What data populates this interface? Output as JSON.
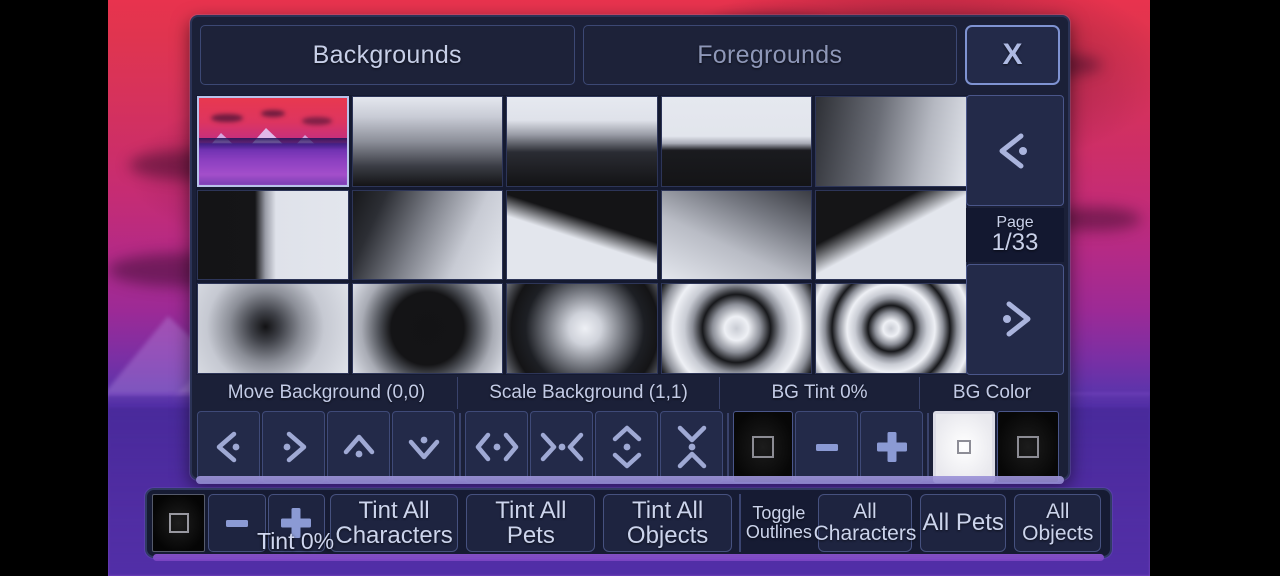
{
  "window": {
    "tabs": [
      {
        "label": "Backgrounds",
        "active": true
      },
      {
        "label": "Foregrounds",
        "active": false
      }
    ],
    "close_label": "X"
  },
  "pager": {
    "prev_icon": "chevron-left-dot-icon",
    "next_icon": "chevron-right-dot-icon",
    "page_word": "Page",
    "page_value": "1/33"
  },
  "grid": {
    "selected_index": 0,
    "thumbnails": [
      {
        "name": "thumb-mountain-scene",
        "kind": "image"
      },
      {
        "name": "thumb-gradient-vertical-light-dark",
        "kind": "gradient"
      },
      {
        "name": "thumb-gradient-vertical-hard-edge",
        "kind": "gradient"
      },
      {
        "name": "thumb-gradient-split-horizontal",
        "kind": "gradient"
      },
      {
        "name": "thumb-gradient-diagonal-dark-light",
        "kind": "gradient"
      },
      {
        "name": "thumb-gradient-vertical-split-left",
        "kind": "gradient"
      },
      {
        "name": "thumb-gradient-diagonal-corner",
        "kind": "gradient"
      },
      {
        "name": "thumb-gradient-triangle-wedge",
        "kind": "gradient"
      },
      {
        "name": "thumb-gradient-soft-diagonal",
        "kind": "gradient"
      },
      {
        "name": "thumb-gradient-angled-beam",
        "kind": "gradient"
      },
      {
        "name": "thumb-radial-small-dark-center",
        "kind": "radial"
      },
      {
        "name": "thumb-radial-large-dark-circle",
        "kind": "radial"
      },
      {
        "name": "thumb-radial-light-center",
        "kind": "radial"
      },
      {
        "name": "thumb-radial-rings-wide",
        "kind": "rings"
      },
      {
        "name": "thumb-radial-rings-tight",
        "kind": "rings"
      }
    ]
  },
  "sections": [
    {
      "name": "move-background",
      "label": "Move Background (0,0)"
    },
    {
      "name": "scale-background",
      "label": "Scale Background (1,1)"
    },
    {
      "name": "bg-tint",
      "label": "BG Tint 0%"
    },
    {
      "name": "bg-color",
      "label": "BG Color"
    }
  ],
  "controls": {
    "move": [
      {
        "name": "move-left-button",
        "icon": "chevron-left-dot-icon"
      },
      {
        "name": "move-right-button",
        "icon": "chevron-right-dot-icon"
      },
      {
        "name": "move-up-button",
        "icon": "chevron-up-dot-icon"
      },
      {
        "name": "move-down-button",
        "icon": "chevron-down-dot-icon"
      }
    ],
    "scale": [
      {
        "name": "scale-expand-horizontal-button",
        "icon": "expand-horizontal-icon"
      },
      {
        "name": "scale-contract-horizontal-button",
        "icon": "contract-horizontal-icon"
      },
      {
        "name": "scale-expand-vertical-button",
        "icon": "expand-vertical-icon"
      },
      {
        "name": "scale-contract-vertical-button",
        "icon": "contract-vertical-icon"
      }
    ],
    "tint": {
      "swatch_name": "bg-tint-swatch",
      "minus_label": "–",
      "plus_label": "+"
    },
    "color": {
      "white_swatch_name": "bg-color-white-swatch",
      "black_swatch_name": "bg-color-black-swatch",
      "selected": "white"
    }
  },
  "toolbar": {
    "tint_swatch_name": "global-tint-swatch",
    "minus_label": "–",
    "plus_label": "+",
    "tint_readout": "Tint 0%",
    "buttons": [
      {
        "name": "tint-all-characters-button",
        "line1": "Tint All",
        "line2": "Characters",
        "size": "b1"
      },
      {
        "name": "tint-all-pets-button",
        "line1": "Tint All",
        "line2": "Pets",
        "size": "b1"
      },
      {
        "name": "tint-all-objects-button",
        "line1": "Tint All",
        "line2": "Objects",
        "size": "b1"
      }
    ],
    "toggle_outlines": {
      "line1": "Toggle",
      "line2": "Outlines"
    },
    "outline_buttons": [
      {
        "name": "all-characters-button",
        "line1": "All",
        "line2": "Characters",
        "size": "b2"
      },
      {
        "name": "all-pets-button",
        "line1": "All Pets",
        "line2": "",
        "size": "b1"
      },
      {
        "name": "all-objects-button",
        "line1": "All",
        "line2": "Objects",
        "size": "b2"
      }
    ]
  },
  "colors": {
    "panel_bg": "#1b2038",
    "panel_border": "#2b3356",
    "accent_text": "#c7cfe8",
    "button_bg": "#232a49",
    "button_border": "#46517f",
    "highlight_border": "#7f93d2",
    "wallpaper_top": "#e8334e",
    "wallpaper_mid": "#b42a86",
    "wallpaper_bottom": "#7b45bf"
  }
}
